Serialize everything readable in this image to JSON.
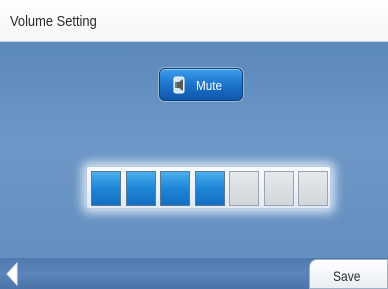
{
  "header": {
    "title": "Volume Setting"
  },
  "mute_button": {
    "label": "Mute",
    "icon": "speaker-icon"
  },
  "volume": {
    "level": 4,
    "max": 7
  },
  "footer": {
    "back_icon": "back-arrow-icon",
    "save_label": "Save"
  },
  "colors": {
    "panel_blue": "#6390c1",
    "segment_on": "#1e86d8",
    "segment_off": "#d3d7db",
    "button_blue": "#1b6fc7"
  }
}
